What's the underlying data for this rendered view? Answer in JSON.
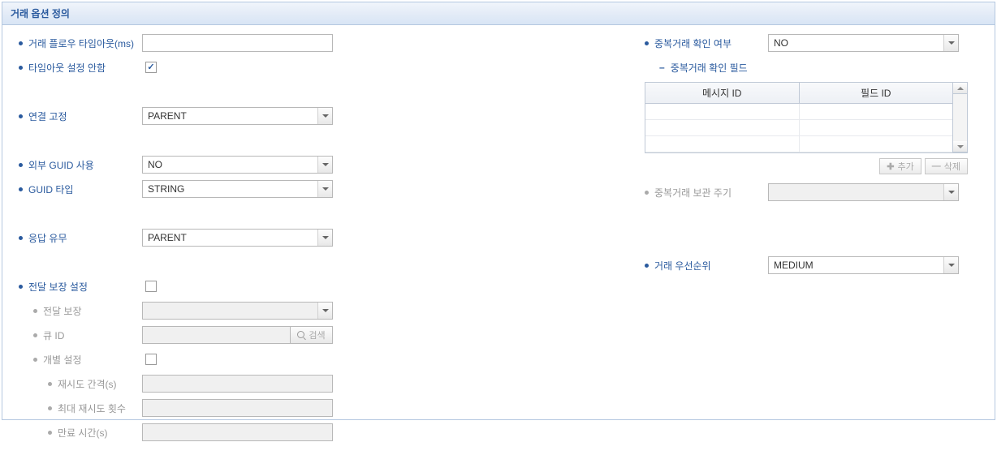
{
  "header": {
    "title": "거래 옵션 정의"
  },
  "left": {
    "timeout_label": "거래 플로우 타임아웃(ms)",
    "timeout_value": "",
    "no_timeout_label": "타임아웃 설정 안함",
    "no_timeout_checked": true,
    "conn_fix_label": "연결 고정",
    "conn_fix_value": "PARENT",
    "ext_guid_label": "외부 GUID 사용",
    "ext_guid_value": "NO",
    "guid_type_label": "GUID 타입",
    "guid_type_value": "STRING",
    "response_label": "응답 유무",
    "response_value": "PARENT",
    "delivery_guarantee_label": "전달 보장 설정",
    "delivery_guarantee_checked": false,
    "delivery_sub_label": "전달 보장",
    "delivery_sub_value": "",
    "queue_id_label": "큐 ID",
    "queue_id_value": "",
    "search_label": "검색",
    "individual_label": "개별 설정",
    "individual_checked": false,
    "retry_interval_label": "재시도 간격(s)",
    "retry_interval_value": "",
    "max_retry_label": "최대 재시도 횟수",
    "max_retry_value": "",
    "expire_label": "만료 시간(s)",
    "expire_value": ""
  },
  "right": {
    "dup_check_label": "중복거래 확인 여부",
    "dup_check_value": "NO",
    "dup_field_label": "중복거래 확인 필드",
    "table": {
      "col1": "메시지 ID",
      "col2": "필드 ID"
    },
    "add_btn": "추가",
    "del_btn": "삭제",
    "dup_keep_label": "중복거래 보관 주기",
    "dup_keep_value": "",
    "priority_label": "거래 우선순위",
    "priority_value": "MEDIUM"
  }
}
